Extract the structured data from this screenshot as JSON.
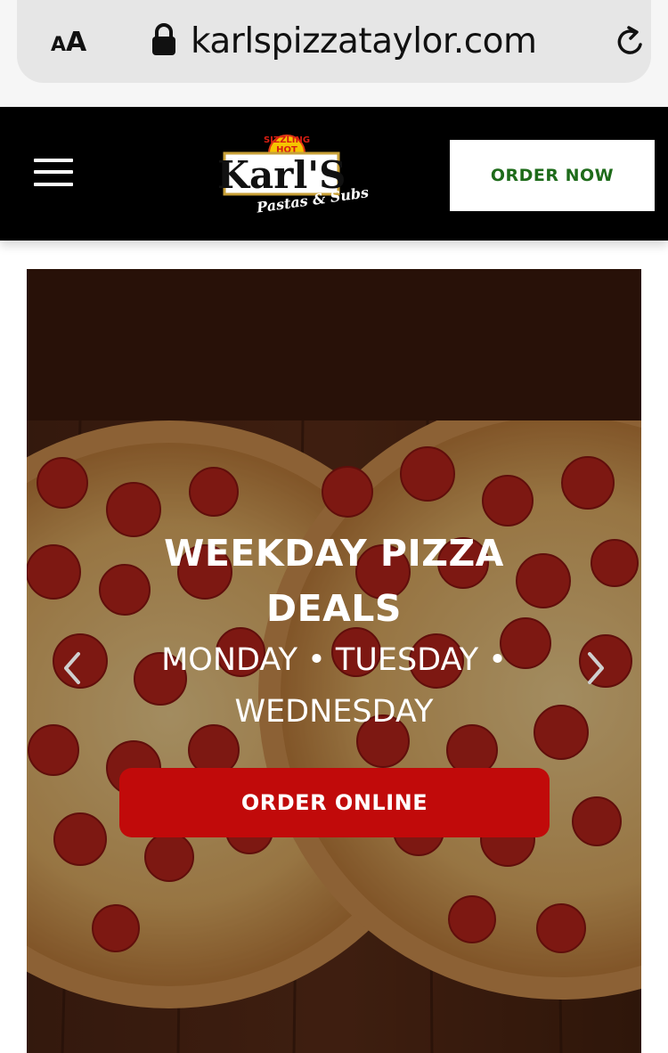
{
  "browser": {
    "text_size_small": "A",
    "text_size_big": "A",
    "url": "karlspizzataylor.com",
    "icons": [
      "lock-icon",
      "reload-icon"
    ]
  },
  "header": {
    "logo_text": {
      "badge": "SIZZLING HOT PIZZA",
      "name": "Karl'S",
      "tagline": "Pastas & Subs"
    },
    "order_now_label": "ORDER NOW",
    "colors": {
      "background": "#000000",
      "order_now_text": "#1e6b1a"
    },
    "icons": [
      "menu-icon"
    ]
  },
  "hero": {
    "title_line1": "WEEKDAY PIZZA",
    "title_line2": "DEALS",
    "subtitle_line1": "MONDAY • TUESDAY •",
    "subtitle_line2": "WEDNESDAY",
    "cta_label": "ORDER ONLINE",
    "colors": {
      "cta": "#c10a0a"
    },
    "icons": [
      "chevron-left-icon",
      "chevron-right-icon"
    ]
  }
}
